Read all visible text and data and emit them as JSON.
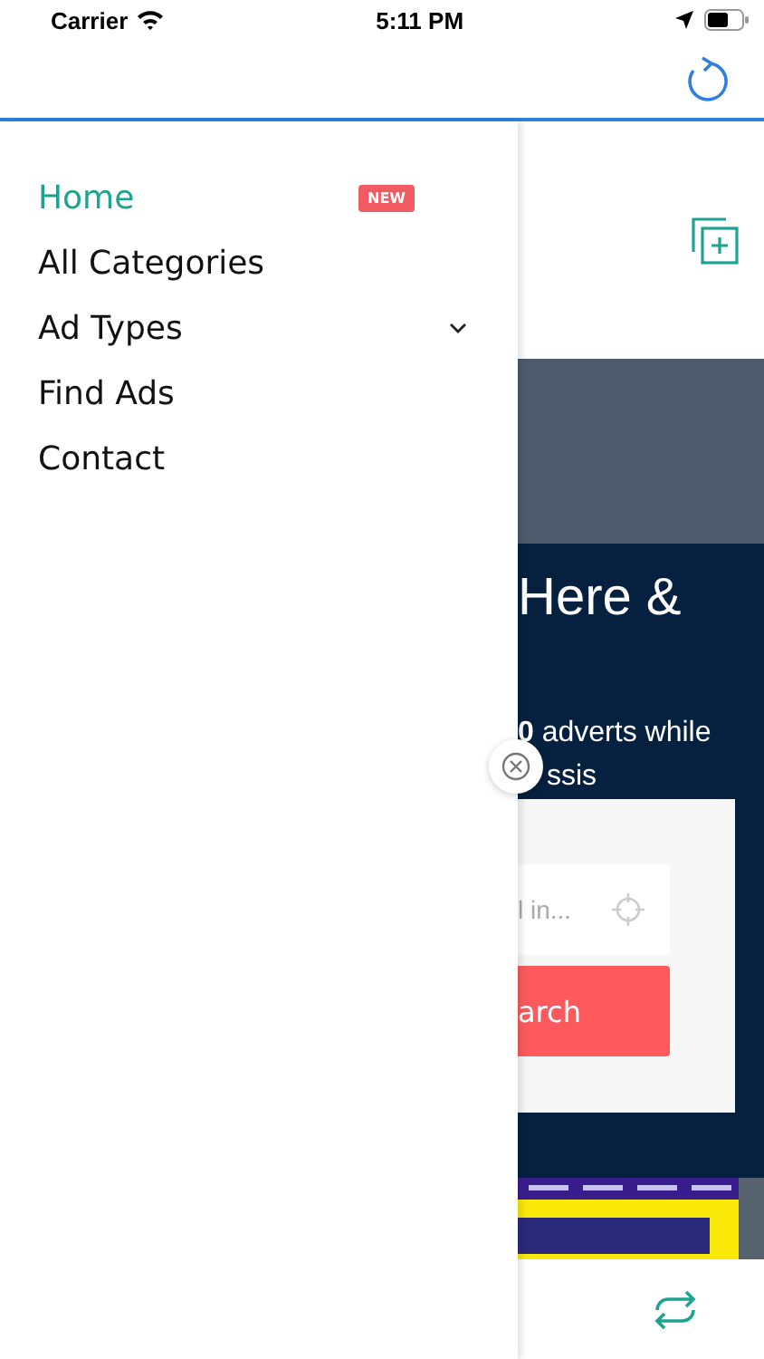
{
  "status_bar": {
    "carrier": "Carrier",
    "time": "5:11 PM"
  },
  "drawer": {
    "items": [
      {
        "label": "Home",
        "selected": true,
        "badge": "NEW"
      },
      {
        "label": "All Categories",
        "selected": false
      },
      {
        "label": "Ad Types",
        "selected": false,
        "expanded": false
      },
      {
        "label": "Find Ads",
        "selected": false
      },
      {
        "label": "Contact",
        "selected": false
      }
    ]
  },
  "hero": {
    "headline": "Here &",
    "text_lines": [
      "**0** adverts while",
      "ssis"
    ],
    "search_card": {
      "location_placeholder": "l in...",
      "button": "arch"
    }
  }
}
